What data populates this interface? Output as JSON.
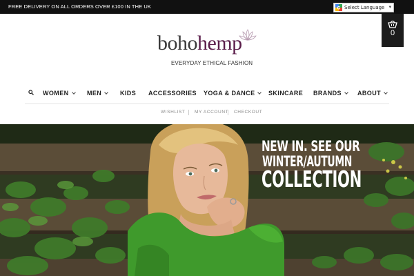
{
  "announcement": {
    "text": "FREE DELIVERY ON ALL ORDERS OVER £100 IN THE UK"
  },
  "language_selector": {
    "label": "Select Language",
    "icon": "google-translate-icon"
  },
  "cart": {
    "count": "0",
    "icon": "basket-icon"
  },
  "logo": {
    "word_part1": "boho",
    "word_part2": "hemp",
    "tagline": "EVERYDAY ETHICAL FASHION",
    "colors": {
      "boho": "#3a3a3a",
      "hemp": "#5a1d4a"
    }
  },
  "nav": {
    "search_icon": "search-icon",
    "items": [
      {
        "label": "WOMEN",
        "dropdown": true
      },
      {
        "label": "MEN",
        "dropdown": true
      },
      {
        "label": "KIDS",
        "dropdown": false
      },
      {
        "label": "ACCESSORIES",
        "dropdown": false
      },
      {
        "label": "YOGA & DANCE",
        "dropdown": true
      },
      {
        "label": "SKINCARE",
        "dropdown": false
      },
      {
        "label": "BRANDS",
        "dropdown": true
      },
      {
        "label": "ABOUT",
        "dropdown": true
      }
    ]
  },
  "subnav": {
    "items": [
      "WISHLIST",
      "MY ACCOUNT",
      "CHECKOUT"
    ]
  },
  "hero": {
    "line1": "NEW IN. SEE OUR",
    "line2": "WINTER/AUTUMN",
    "line3": "COLLECTION"
  }
}
